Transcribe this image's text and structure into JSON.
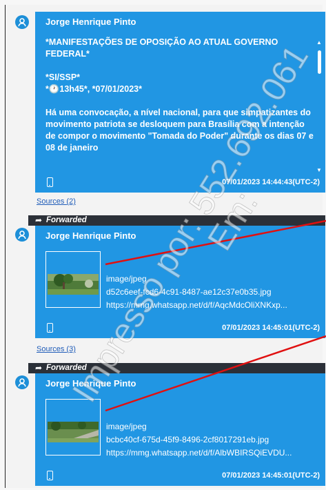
{
  "messages": [
    {
      "sender": "Jorge Henrique Pinto",
      "text": "*MANIFESTAÇÕES DE OPOSIÇÃO AO ATUAL GOVERNO FEDERAL*\n\n*SI/SSP*\n*🕐13h45*, *07/01/2023*\n\nHá uma convocação, a nível nacional, para que simpatizantes do movimento patriota se desloquem para Brasília com a intenção de compor o movimento \"Tomada do Poder\" durante os dias 07 e 08 de janeiro",
      "timestamp": "07/01/2023 14:44:43(UTC-2)",
      "sources": "Sources (2)"
    },
    {
      "forwarded": "Forwarded",
      "sender": "Jorge Henrique Pinto",
      "mime": "image/jpeg",
      "filename": "d52c6eef-fcd6-4c91-8487-ae12c37e0b35.jpg",
      "url": "https://mmg.whatsapp.net/d/f/AqcMdcOliXNKxp...",
      "timestamp": "07/01/2023 14:45:01(UTC-2)",
      "sources": "Sources (3)"
    },
    {
      "forwarded": "Forwarded",
      "sender": "Jorge Henrique Pinto",
      "mime": "image/jpeg",
      "filename": "bcbc40cf-675d-45f9-8496-2cf8017291eb.jpg",
      "url": "https://mmg.whatsapp.net/d/f/AlbWBIRSQiEVDU...",
      "timestamp": "07/01/2023 14:45:01(UTC-2)"
    }
  ],
  "watermark": {
    "line1": "Impresso por: 552.692.061",
    "line2": "Em:"
  },
  "colors": {
    "bubble": "#2196e3",
    "forward_bar": "#2b3038",
    "link": "#1f5cb8",
    "annotation_line": "#e01010"
  },
  "icons": [
    "user-avatar-icon",
    "phone-icon",
    "forward-arrow-icon",
    "scroll-arrow-icon"
  ]
}
